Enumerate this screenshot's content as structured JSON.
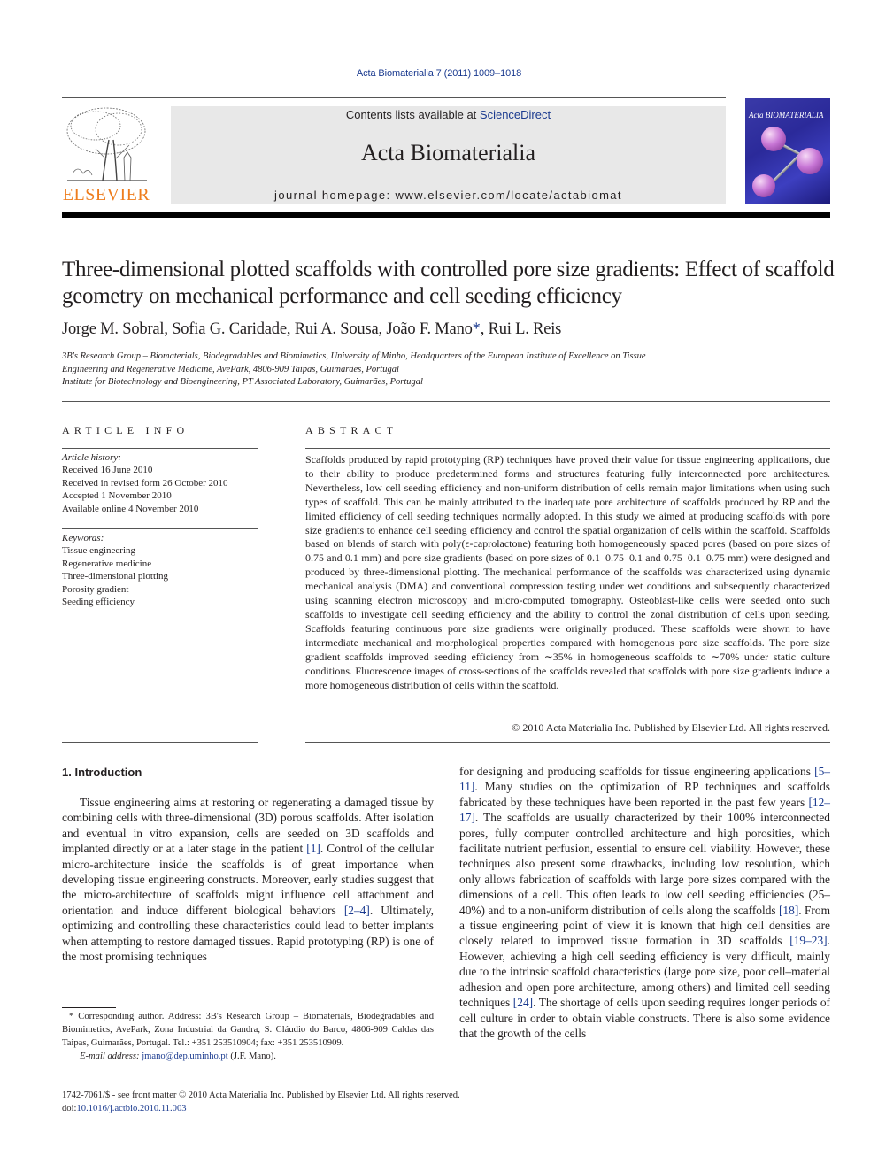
{
  "header": {
    "citation": "Acta Biomaterialia 7 (2011) 1009–1018",
    "publisher_logo_text": "ELSEVIER",
    "contents_prefix": "Contents lists available at ",
    "contents_link": "ScienceDirect",
    "journal_name": "Acta Biomaterialia",
    "homepage_label": "journal homepage: ",
    "homepage_url": "www.elsevier.com/locate/actabiomat",
    "cover_title": "Acta BIOMATERIALIA"
  },
  "article": {
    "title": "Three-dimensional plotted scaffolds with controlled pore size gradients: Effect of scaffold geometry on mechanical performance and cell seeding efficiency",
    "authors_before_star": "Jorge M. Sobral, Sofia G. Caridade, Rui A. Sousa, João F. Mano",
    "star": "*",
    "authors_after_star": ", Rui L. Reis",
    "affiliations": [
      "3B's Research Group – Biomaterials, Biodegradables and Biomimetics, University of Minho, Headquarters of the European Institute of Excellence on Tissue",
      "Engineering and Regenerative Medicine, AvePark, 4806-909 Taipas, Guimarães, Portugal",
      "Institute for Biotechnology and Bioengineering, PT Associated Laboratory, Guimarães, Portugal"
    ]
  },
  "article_info": {
    "heading": "ARTICLE INFO",
    "history_label": "Article history:",
    "history": [
      "Received 16 June 2010",
      "Received in revised form 26 October 2010",
      "Accepted 1 November 2010",
      "Available online 4 November 2010"
    ],
    "keywords_label": "Keywords:",
    "keywords": [
      "Tissue engineering",
      "Regenerative medicine",
      "Three-dimensional plotting",
      "Porosity gradient",
      "Seeding efficiency"
    ]
  },
  "abstract": {
    "heading": "ABSTRACT",
    "text": "Scaffolds produced by rapid prototyping (RP) techniques have proved their value for tissue engineering applications, due to their ability to produce predetermined forms and structures featuring fully interconnected pore architectures. Nevertheless, low cell seeding efficiency and non-uniform distribution of cells remain major limitations when using such types of scaffold. This can be mainly attributed to the inadequate pore architecture of scaffolds produced by RP and the limited efficiency of cell seeding techniques normally adopted. In this study we aimed at producing scaffolds with pore size gradients to enhance cell seeding efficiency and control the spatial organization of cells within the scaffold. Scaffolds based on blends of starch with poly(ε-caprolactone) featuring both homogeneously spaced pores (based on pore sizes of 0.75 and 0.1 mm) and pore size gradients (based on pore sizes of 0.1–0.75–0.1 and 0.75–0.1–0.75 mm) were designed and produced by three-dimensional plotting. The mechanical performance of the scaffolds was characterized using dynamic mechanical analysis (DMA) and conventional compression testing under wet conditions and subsequently characterized using scanning electron microscopy and micro-computed tomography. Osteoblast-like cells were seeded onto such scaffolds to investigate cell seeding efficiency and the ability to control the zonal distribution of cells upon seeding. Scaffolds featuring continuous pore size gradients were originally produced. These scaffolds were shown to have intermediate mechanical and morphological properties compared with homogenous pore size scaffolds. The pore size gradient scaffolds improved seeding efficiency from ∼35% in homogeneous scaffolds to ∼70% under static culture conditions. Fluorescence images of cross-sections of the scaffolds revealed that scaffolds with pore size gradients induce a more homogeneous distribution of cells within the scaffold.",
    "copyright": "© 2010 Acta Materialia Inc. Published by Elsevier Ltd. All rights reserved."
  },
  "introduction": {
    "heading": "1. Introduction",
    "left": [
      {
        "t": "Tissue engineering aims at restoring or regenerating a damaged tissue by combining cells with three-dimensional (3D) porous scaffolds. After isolation and eventual in vitro expansion, cells are seeded on 3D scaffolds and implanted directly or at a later stage in the patient "
      },
      {
        "ref": "[1]"
      },
      {
        "t": ". Control of the cellular micro-architecture inside the scaffolds is of great importance when developing tissue engineering constructs. Moreover, early studies suggest that the micro-architecture of scaffolds might influence cell attachment and orientation and induce different biological behaviors "
      },
      {
        "ref": "[2–4]"
      },
      {
        "t": ". Ultimately, optimizing and controlling these characteristics could lead to better implants when attempting to restore damaged tissues. Rapid prototyping (RP) is one of the most promising techniques"
      }
    ],
    "right": [
      {
        "t": "for designing and producing scaffolds for tissue engineering applications "
      },
      {
        "ref": "[5–11]"
      },
      {
        "t": ". Many studies on the optimization of RP techniques and scaffolds fabricated by these techniques have been reported in the past few years "
      },
      {
        "ref": "[12–17]"
      },
      {
        "t": ". The scaffolds are usually characterized by their 100% interconnected pores, fully computer controlled architecture and high porosities, which facilitate nutrient perfusion, essential to ensure cell viability. However, these techniques also present some drawbacks, including low resolution, which only allows fabrication of scaffolds with large pore sizes compared with the dimensions of a cell. This often leads to low cell seeding efficiencies (25–40%) and to a non-uniform distribution of cells along the scaffolds "
      },
      {
        "ref": "[18]"
      },
      {
        "t": ". From a tissue engineering point of view it is known that high cell densities are closely related to improved tissue formation in 3D scaffolds "
      },
      {
        "ref": "[19–23]"
      },
      {
        "t": ". However, achieving a high cell seeding efficiency is very difficult, mainly due to the intrinsic scaffold characteristics (large pore size, poor cell–material adhesion and open pore architecture, among others) and limited cell seeding techniques "
      },
      {
        "ref": "[24]"
      },
      {
        "t": ". The shortage of cells upon seeding requires longer periods of cell culture in order to obtain viable constructs. There is also some evidence that the growth of the cells"
      }
    ]
  },
  "footnote": {
    "star": "*",
    "text": " Corresponding author. Address: 3B's Research Group – Biomaterials, Biodegradables and Biomimetics, AvePark, Zona Industrial da Gandra, S. Cláudio do Barco, 4806-909 Caldas das Taipas, Guimarães, Portugal. Tel.: +351 253510904; fax: +351 253510909.",
    "email_label": "E-mail address: ",
    "email": "jmano@dep.uminho.pt",
    "email_suffix": " (J.F. Mano)."
  },
  "footer": {
    "issn_line": "1742-7061/$ - see front matter © 2010 Acta Materialia Inc. Published by Elsevier Ltd. All rights reserved.",
    "doi_label": "doi:",
    "doi": "10.1016/j.actbio.2010.11.003"
  },
  "colors": {
    "link": "#1a3a8f",
    "elsevier_orange": "#ee7d1e",
    "banner_bg": "#e8e8e8",
    "text": "#231f20"
  }
}
